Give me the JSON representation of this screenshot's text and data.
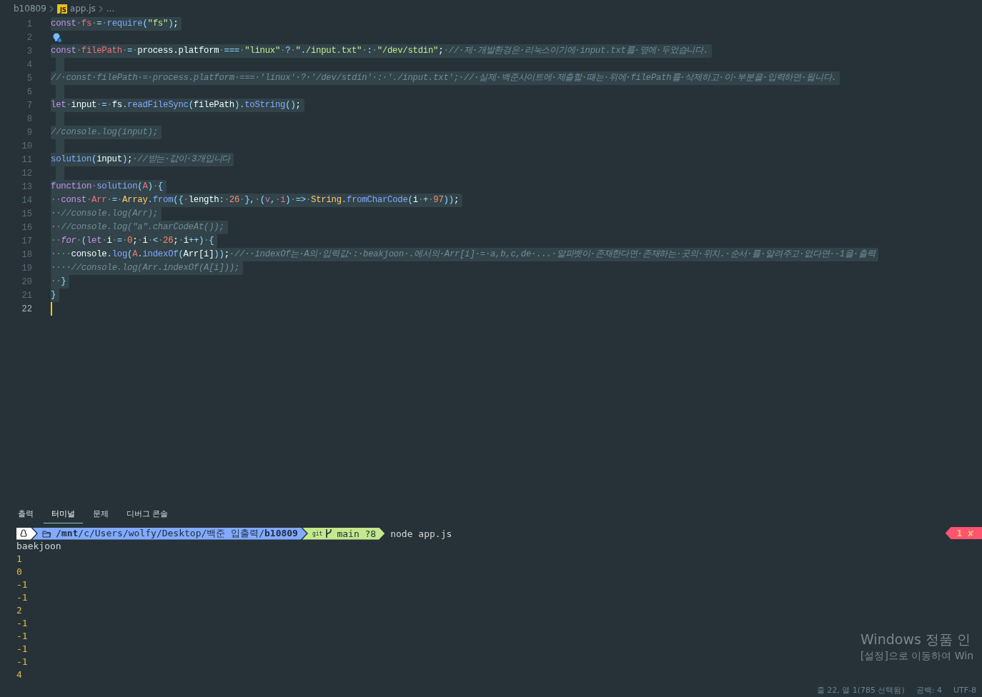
{
  "breadcrumb": {
    "folder": "b10809",
    "file_icon": "JS",
    "file": "app.js",
    "more": "..."
  },
  "editor": {
    "lines": [
      {
        "num": "1",
        "kind": "code",
        "tokens": [
          {
            "kind": "keyword",
            "text": "const·"
          },
          {
            "kind": "variable",
            "text": "fs·"
          },
          {
            "kind": "operator",
            "text": "=·"
          },
          {
            "kind": "function",
            "text": "require"
          },
          {
            "kind": "operator",
            "text": "("
          },
          {
            "kind": "string",
            "text": "\"fs\""
          },
          {
            "kind": "operator",
            "text": ")"
          },
          {
            "kind": "plain",
            "text": ";"
          }
        ]
      },
      {
        "num": "2",
        "kind": "hint"
      },
      {
        "num": "3",
        "kind": "code",
        "tokens": [
          {
            "kind": "keyword",
            "text": "const·"
          },
          {
            "kind": "variable",
            "text": "filePath·"
          },
          {
            "kind": "operator",
            "text": "=·"
          },
          {
            "kind": "plain",
            "text": "process.platform·"
          },
          {
            "kind": "operator",
            "text": "===·"
          },
          {
            "kind": "string",
            "text": "\"linux\"·"
          },
          {
            "kind": "operator",
            "text": "?·"
          },
          {
            "kind": "string",
            "text": "\"./input.txt\"·"
          },
          {
            "kind": "operator",
            "text": ":·"
          },
          {
            "kind": "string",
            "text": "\"/dev/stdin\""
          },
          {
            "kind": "plain",
            "text": ";·"
          },
          {
            "kind": "comment",
            "text": "//·제·개발환경은·리눅스이기에·input.txt를·옆에·두었습니다."
          }
        ]
      },
      {
        "num": "4",
        "kind": "blank"
      },
      {
        "num": "5",
        "kind": "code",
        "tokens": [
          {
            "kind": "comment",
            "text": "//·const·filePath·=·process.platform·===·'linux'·?·'/dev/stdin'·:·'./input.txt';·//·실제·백준사이트에·제출할·때는·위에·filePath를·삭제하고·이·부분을·입력하면·됩니다."
          }
        ]
      },
      {
        "num": "6",
        "kind": "blank"
      },
      {
        "num": "7",
        "kind": "code",
        "tokens": [
          {
            "kind": "keyword",
            "text": "let·"
          },
          {
            "kind": "plain",
            "text": "input·"
          },
          {
            "kind": "operator",
            "text": "=·"
          },
          {
            "kind": "plain",
            "text": "fs"
          },
          {
            "kind": "operator",
            "text": "."
          },
          {
            "kind": "function",
            "text": "readFileSync"
          },
          {
            "kind": "operator",
            "text": "("
          },
          {
            "kind": "plain",
            "text": "filePath"
          },
          {
            "kind": "operator",
            "text": ")."
          },
          {
            "kind": "function",
            "text": "toString"
          },
          {
            "kind": "operator",
            "text": "()"
          },
          {
            "kind": "plain",
            "text": ";"
          }
        ]
      },
      {
        "num": "8",
        "kind": "blank"
      },
      {
        "num": "9",
        "kind": "code",
        "tokens": [
          {
            "kind": "comment",
            "text": "//console.log(input);"
          }
        ]
      },
      {
        "num": "10",
        "kind": "blank"
      },
      {
        "num": "11",
        "kind": "code",
        "tokens": [
          {
            "kind": "function",
            "text": "solution"
          },
          {
            "kind": "operator",
            "text": "("
          },
          {
            "kind": "plain",
            "text": "input"
          },
          {
            "kind": "operator",
            "text": ")"
          },
          {
            "kind": "plain",
            "text": ";·"
          },
          {
            "kind": "comment",
            "text": "//받는·값이·3개입니다"
          }
        ]
      },
      {
        "num": "12",
        "kind": "blank"
      },
      {
        "num": "13",
        "kind": "code",
        "tokens": [
          {
            "kind": "keyword",
            "text": "function·"
          },
          {
            "kind": "function",
            "text": "solution"
          },
          {
            "kind": "operator",
            "text": "("
          },
          {
            "kind": "variable",
            "text": "A"
          },
          {
            "kind": "operator",
            "text": ")·{"
          }
        ]
      },
      {
        "num": "14",
        "kind": "code",
        "tokens": [
          {
            "kind": "plain",
            "text": "··"
          },
          {
            "kind": "keyword",
            "text": "const·"
          },
          {
            "kind": "variable",
            "text": "Arr·"
          },
          {
            "kind": "operator",
            "text": "=·"
          },
          {
            "kind": "class",
            "text": "Array"
          },
          {
            "kind": "operator",
            "text": "."
          },
          {
            "kind": "function",
            "text": "from"
          },
          {
            "kind": "operator",
            "text": "({·"
          },
          {
            "kind": "plain",
            "text": "length"
          },
          {
            "kind": "operator",
            "text": ":·"
          },
          {
            "kind": "number",
            "text": "26·"
          },
          {
            "kind": "operator",
            "text": "},·("
          },
          {
            "kind": "parameter",
            "text": "v"
          },
          {
            "kind": "operator",
            "text": ",·"
          },
          {
            "kind": "variable",
            "text": "i"
          },
          {
            "kind": "operator",
            "text": ")·=>·"
          },
          {
            "kind": "class",
            "text": "String"
          },
          {
            "kind": "operator",
            "text": "."
          },
          {
            "kind": "function",
            "text": "fromCharCode"
          },
          {
            "kind": "operator",
            "text": "("
          },
          {
            "kind": "plain",
            "text": "i·"
          },
          {
            "kind": "operator",
            "text": "+·"
          },
          {
            "kind": "number",
            "text": "97"
          },
          {
            "kind": "operator",
            "text": "))"
          },
          {
            "kind": "plain",
            "text": ";"
          }
        ]
      },
      {
        "num": "15",
        "kind": "code",
        "tokens": [
          {
            "kind": "comment",
            "text": "··//console.log(Arr);"
          }
        ]
      },
      {
        "num": "16",
        "kind": "code",
        "tokens": [
          {
            "kind": "comment",
            "text": "··//console.log(\"a\".charCodeAt());"
          }
        ]
      },
      {
        "num": "17",
        "kind": "code",
        "tokens": [
          {
            "kind": "plain",
            "text": "··"
          },
          {
            "kind": "keyword_italic",
            "text": "for·"
          },
          {
            "kind": "operator",
            "text": "("
          },
          {
            "kind": "keyword",
            "text": "let·"
          },
          {
            "kind": "plain",
            "text": "i·"
          },
          {
            "kind": "operator",
            "text": "=·"
          },
          {
            "kind": "number",
            "text": "0"
          },
          {
            "kind": "plain",
            "text": ";·i·"
          },
          {
            "kind": "operator",
            "text": "<·"
          },
          {
            "kind": "number",
            "text": "26"
          },
          {
            "kind": "plain",
            "text": ";·i"
          },
          {
            "kind": "operator",
            "text": "++)·{"
          }
        ]
      },
      {
        "num": "18",
        "kind": "code",
        "tokens": [
          {
            "kind": "plain",
            "text": "····console"
          },
          {
            "kind": "operator",
            "text": "."
          },
          {
            "kind": "function",
            "text": "log"
          },
          {
            "kind": "operator",
            "text": "("
          },
          {
            "kind": "variable",
            "text": "A"
          },
          {
            "kind": "operator",
            "text": "."
          },
          {
            "kind": "function",
            "text": "indexOf"
          },
          {
            "kind": "operator",
            "text": "("
          },
          {
            "kind": "plain",
            "text": "Arr[i]"
          },
          {
            "kind": "operator",
            "text": "))"
          },
          {
            "kind": "plain",
            "text": ";·"
          },
          {
            "kind": "comment",
            "text": "//··indexOf는·A의·입력값·:·beakjoon·.에서의·Arr[i]·=·a,b,c,de·...·알파벳이·존재한다면·존재하는·곳의·위치.·순서·를·알려주고·없다면·-1을·출력"
          }
        ]
      },
      {
        "num": "19",
        "kind": "code",
        "tokens": [
          {
            "kind": "comment",
            "text": "····//console.log(Arr.indexOf(A[i]));"
          }
        ]
      },
      {
        "num": "20",
        "kind": "code",
        "tokens": [
          {
            "kind": "operator",
            "text": "··}"
          }
        ]
      },
      {
        "num": "21",
        "kind": "code",
        "tokens": [
          {
            "kind": "operator",
            "text": "}"
          }
        ]
      },
      {
        "num": "22",
        "kind": "caret"
      }
    ]
  },
  "panel": {
    "tabs": [
      {
        "label": "출력",
        "selected": false
      },
      {
        "label": "터미널",
        "selected": true
      },
      {
        "label": "문제",
        "selected": false
      },
      {
        "label": "디버그 콘솔",
        "selected": false
      }
    ],
    "prompt": {
      "path": "**/mnt**/c/Users/wolfy/Desktop/백준 입출력/**b10809**",
      "git_label": "git",
      "branch": "main ?8",
      "command": "node app.js",
      "error_status": "1 ✘"
    },
    "output": [
      {
        "text": "baekjoon",
        "kind": "text"
      },
      {
        "text": "1",
        "kind": "number"
      },
      {
        "text": "0",
        "kind": "number"
      },
      {
        "text": "-1",
        "kind": "number"
      },
      {
        "text": "-1",
        "kind": "number"
      },
      {
        "text": "2",
        "kind": "number"
      },
      {
        "text": "-1",
        "kind": "number"
      },
      {
        "text": "-1",
        "kind": "number"
      },
      {
        "text": "-1",
        "kind": "number"
      },
      {
        "text": "-1",
        "kind": "number"
      },
      {
        "text": "4",
        "kind": "number"
      }
    ]
  },
  "activation_notice": {
    "title": "Windows 정품 인",
    "subtitle": "[설정]으로 이동하여 Win"
  },
  "status_bar": {
    "position": "줄 22, 열 1(785 선택됨)",
    "indent": "공백: 4",
    "encoding": "UTF-8"
  }
}
